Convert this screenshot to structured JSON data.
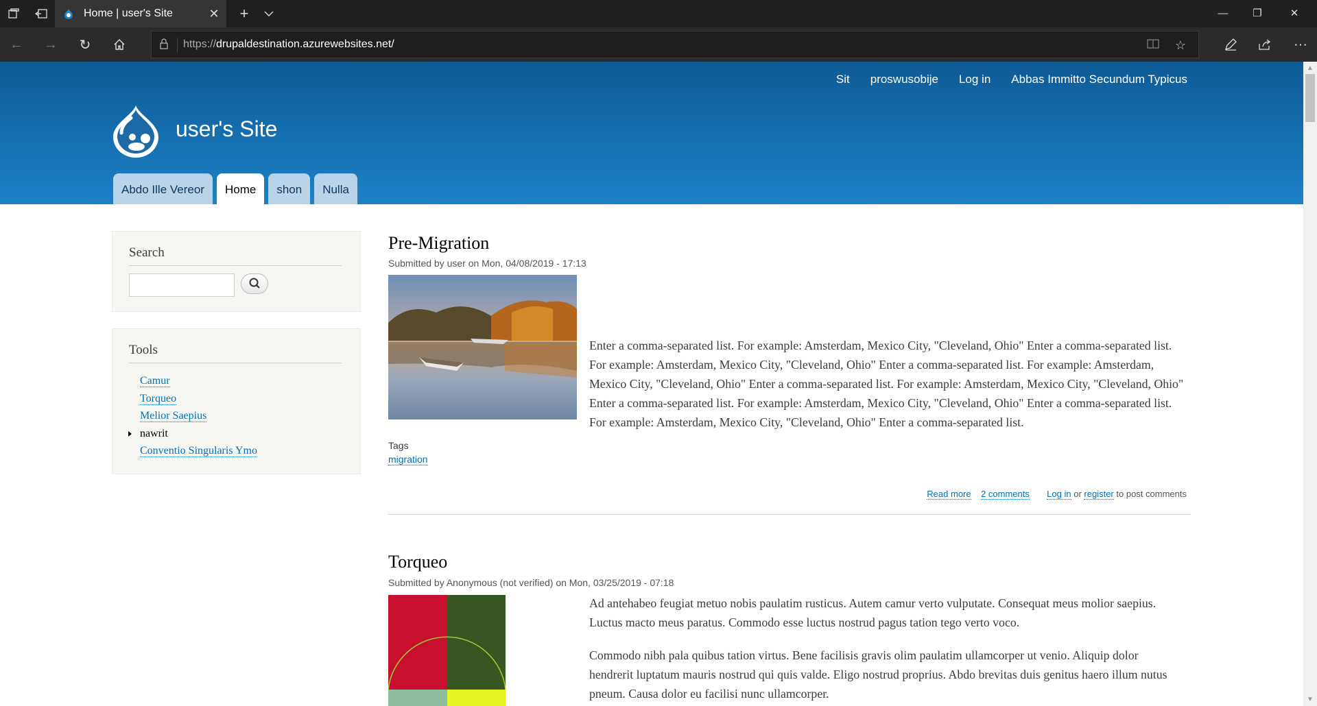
{
  "browser": {
    "tab_title": "Home | user's Site",
    "url_scheme": "https://",
    "url_host": "drupaldestination.azurewebsites.net/"
  },
  "site": {
    "secondary_menu": [
      "Sit",
      "proswusobije",
      "Log in",
      "Abbas Immitto Secundum Typicus"
    ],
    "name": "user's Site",
    "main_menu": [
      {
        "label": "Abdo Ille Vereor",
        "active": false
      },
      {
        "label": "Home",
        "active": true
      },
      {
        "label": "shon",
        "active": false
      },
      {
        "label": "Nulla",
        "active": false
      }
    ]
  },
  "sidebar": {
    "search_title": "Search",
    "search_value": "",
    "tools_title": "Tools",
    "tools_items": [
      "Camur",
      "Torqueo",
      "Melior Saepius",
      "nawrit",
      "Conventio Singularis Ymo"
    ]
  },
  "nodes": [
    {
      "title": "Pre-Migration",
      "submitted": "Submitted by user on Mon, 04/08/2019 - 17:13",
      "body": [
        "Enter a comma-separated list. For example: Amsterdam, Mexico City, \"Cleveland, Ohio\" Enter a comma-separated list. For example: Amsterdam, Mexico City, \"Cleveland, Ohio\" Enter a comma-separated list. For example: Amsterdam, Mexico City, \"Cleveland, Ohio\" Enter a comma-separated list. For example: Amsterdam, Mexico City, \"Cleveland, Ohio\" Enter a comma-separated list. For example: Amsterdam, Mexico City, \"Cleveland, Ohio\" Enter a comma-separated list. For example: Amsterdam, Mexico City, \"Cleveland, Ohio\" Enter a comma-separated list."
      ],
      "tags_label": "Tags",
      "tags": [
        "migration"
      ],
      "links": {
        "read_more": "Read more",
        "comments": "2 comments",
        "login": "Log in",
        "or": "or",
        "register": "register",
        "post_comments": "to post comments"
      }
    },
    {
      "title": "Torqueo",
      "submitted": "Submitted by Anonymous (not verified) on Mon, 03/25/2019 - 07:18",
      "body": [
        "Ad antehabeo feugiat metuo nobis paulatim rusticus. Autem camur verto vulputate. Consequat meus molior saepius. Luctus macto meus paratus. Commodo esse luctus nostrud pagus tation tego verto voco.",
        "Commodo nibh pala quibus tation virtus. Bene facilisis gravis olim paulatim ullamcorper ut venio. Aliquip dolor hendrerit luptatum mauris nostrud qui quis valde. Eligo nostrud proprius. Abdo brevitas duis genitus haero illum nutus pneum. Causa dolor eu facilisi nunc ullamcorper."
      ]
    }
  ]
}
